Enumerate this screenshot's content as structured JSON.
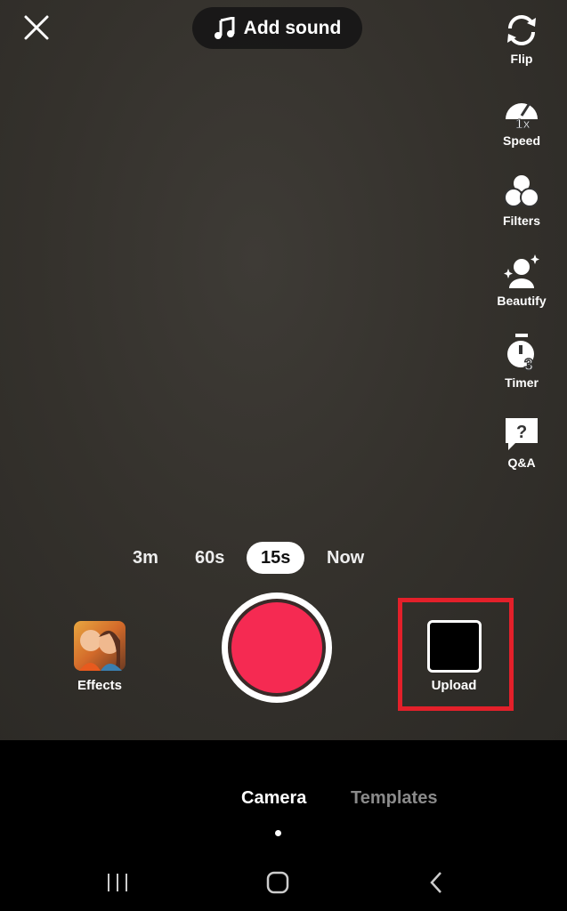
{
  "top": {
    "add_sound": "Add sound"
  },
  "side_tools": [
    {
      "label": "Flip",
      "icon": "flip-icon"
    },
    {
      "label": "Speed",
      "icon": "speed-icon"
    },
    {
      "label": "Filters",
      "icon": "filters-icon"
    },
    {
      "label": "Beautify",
      "icon": "beautify-icon"
    },
    {
      "label": "Timer",
      "icon": "timer-icon"
    },
    {
      "label": "Q&A",
      "icon": "qa-icon"
    }
  ],
  "durations": [
    {
      "label": "3m"
    },
    {
      "label": "60s"
    },
    {
      "label": "15s",
      "selected": true
    },
    {
      "label": "Now"
    }
  ],
  "effects_label": "Effects",
  "upload_label": "Upload",
  "tabs": {
    "camera": "Camera",
    "templates": "Templates"
  },
  "colors": {
    "record": "#f52a52",
    "highlight": "#e3202a"
  }
}
